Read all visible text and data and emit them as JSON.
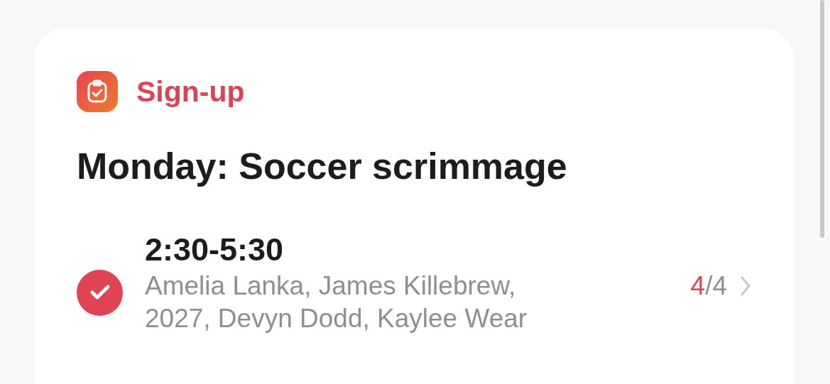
{
  "card": {
    "category": "Sign-up",
    "title": "Monday: Soccer scrimmage",
    "slots": [
      {
        "time": "2:30-5:30",
        "checked": true,
        "names": "Amelia Lanka, James Killebrew, 2027, Devyn Dodd, Kaylee Wear",
        "filled": "4",
        "separator": "/",
        "capacity": "4"
      }
    ]
  }
}
